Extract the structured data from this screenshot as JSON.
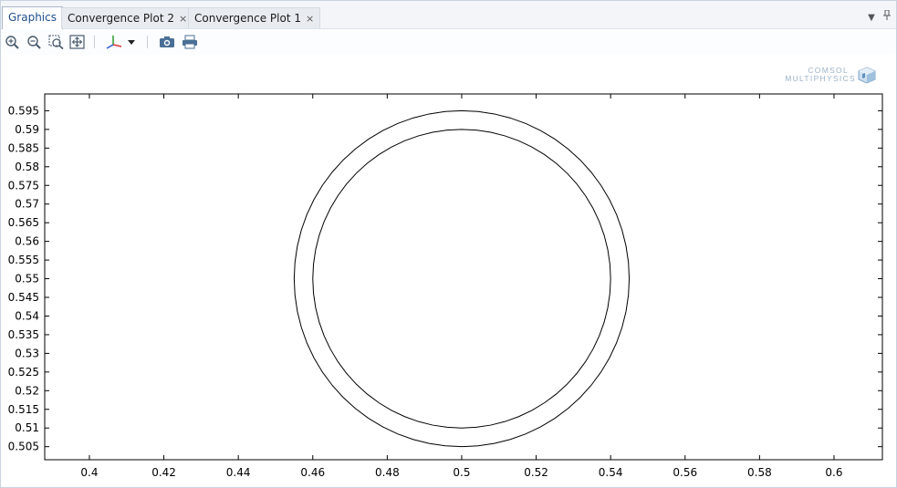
{
  "tabs": [
    {
      "label": "Graphics",
      "active": true,
      "closable": false
    },
    {
      "label": "Convergence Plot 2",
      "active": false,
      "closable": true
    },
    {
      "label": "Convergence Plot 1",
      "active": false,
      "closable": true
    }
  ],
  "tab_close_glyph": "×",
  "toolbar": {
    "buttons": [
      "zoom-in-icon",
      "zoom-out-icon",
      "zoom-box-icon",
      "zoom-extents-icon",
      "axis-orientation-icon",
      "dropdown-arrow-icon",
      "camera-icon",
      "print-icon"
    ]
  },
  "logo": {
    "line1": "COMSOL",
    "line2": "MULTIPHYSICS"
  },
  "chart_data": {
    "type": "line",
    "title": "",
    "xlabel": "",
    "ylabel": "",
    "xlim": [
      0.388,
      0.613
    ],
    "ylim": [
      0.5015,
      0.5995
    ],
    "xticks": [
      0.4,
      0.42,
      0.44,
      0.46,
      0.48,
      0.5,
      0.52,
      0.54,
      0.56,
      0.58,
      0.6
    ],
    "xtick_labels": [
      "0.4",
      "0.42",
      "0.44",
      "0.46",
      "0.48",
      "0.5",
      "0.52",
      "0.54",
      "0.56",
      "0.58",
      "0.6"
    ],
    "yticks": [
      0.505,
      0.51,
      0.515,
      0.52,
      0.525,
      0.53,
      0.535,
      0.54,
      0.545,
      0.55,
      0.555,
      0.56,
      0.565,
      0.57,
      0.575,
      0.58,
      0.585,
      0.59,
      0.595
    ],
    "ytick_labels": [
      "0.505",
      "0.51",
      "0.515",
      "0.52",
      "0.525",
      "0.53",
      "0.535",
      "0.54",
      "0.545",
      "0.55",
      "0.555",
      "0.56",
      "0.565",
      "0.57",
      "0.575",
      "0.58",
      "0.585",
      "0.59",
      "0.595"
    ],
    "grid": false,
    "series": [
      {
        "shape": "circle",
        "center": [
          0.5,
          0.55
        ],
        "radius": 0.045,
        "segments": 64,
        "color": "#000000"
      },
      {
        "shape": "circle",
        "center": [
          0.5,
          0.55
        ],
        "radius": 0.04,
        "segments": 64,
        "color": "#000000"
      }
    ]
  }
}
